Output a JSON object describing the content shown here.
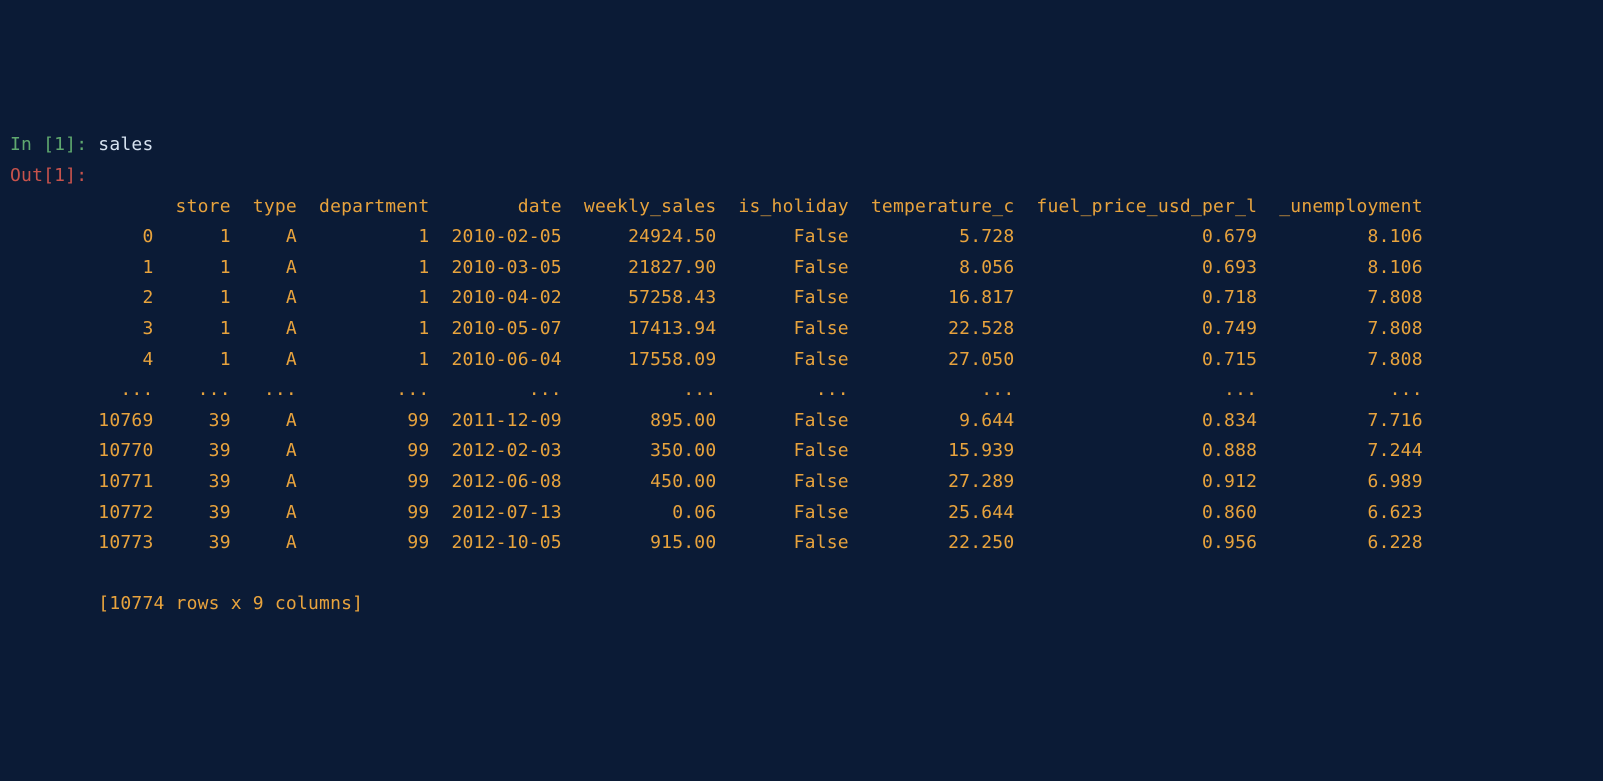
{
  "prompt": {
    "in_label": "In [1]: ",
    "out_label": "Out[1]:",
    "code": "sales"
  },
  "df": {
    "columns": [
      "store",
      "type",
      "department",
      "date",
      "weekly_sales",
      "is_holiday",
      "temperature_c",
      "fuel_price_usd_per_l",
      "_unemployment"
    ],
    "indices": [
      "0",
      "1",
      "2",
      "3",
      "4",
      "...",
      "10769",
      "10770",
      "10771",
      "10772",
      "10773"
    ],
    "rows": [
      [
        "1",
        "A",
        "1",
        "2010-02-05",
        "24924.50",
        "False",
        "5.728",
        "0.679",
        "8.106"
      ],
      [
        "1",
        "A",
        "1",
        "2010-03-05",
        "21827.90",
        "False",
        "8.056",
        "0.693",
        "8.106"
      ],
      [
        "1",
        "A",
        "1",
        "2010-04-02",
        "57258.43",
        "False",
        "16.817",
        "0.718",
        "7.808"
      ],
      [
        "1",
        "A",
        "1",
        "2010-05-07",
        "17413.94",
        "False",
        "22.528",
        "0.749",
        "7.808"
      ],
      [
        "1",
        "A",
        "1",
        "2010-06-04",
        "17558.09",
        "False",
        "27.050",
        "0.715",
        "7.808"
      ],
      [
        "...",
        "...",
        "...",
        "...",
        "...",
        "...",
        "...",
        "...",
        "..."
      ],
      [
        "39",
        "A",
        "99",
        "2011-12-09",
        "895.00",
        "False",
        "9.644",
        "0.834",
        "7.716"
      ],
      [
        "39",
        "A",
        "99",
        "2012-02-03",
        "350.00",
        "False",
        "15.939",
        "0.888",
        "7.244"
      ],
      [
        "39",
        "A",
        "99",
        "2012-06-08",
        "450.00",
        "False",
        "27.289",
        "0.912",
        "6.989"
      ],
      [
        "39",
        "A",
        "99",
        "2012-07-13",
        "0.06",
        "False",
        "25.644",
        "0.860",
        "6.623"
      ],
      [
        "39",
        "A",
        "99",
        "2012-10-05",
        "915.00",
        "False",
        "22.250",
        "0.956",
        "6.228"
      ]
    ],
    "footer": "[10774 rows x 9 columns]"
  },
  "col_widths": {
    "index": 5,
    "store": 6,
    "type": 5,
    "department": 11,
    "date": 11,
    "weekly_sales": 13,
    "is_holiday": 11,
    "temperature_c": 14,
    "fuel_price_usd_per_l": 21,
    "_unemployment": 14
  },
  "indent": "        "
}
